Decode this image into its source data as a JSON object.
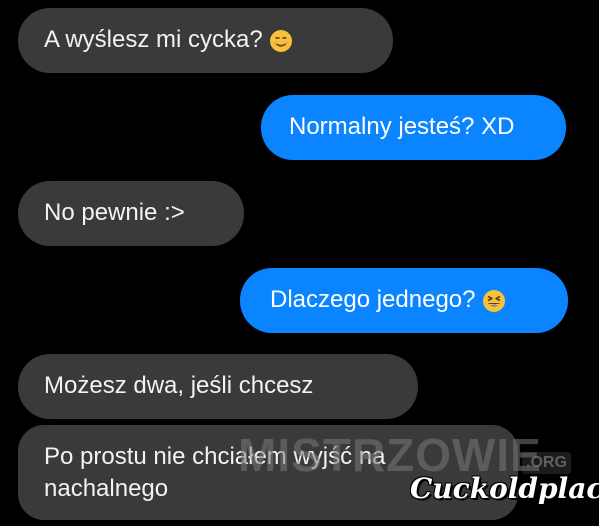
{
  "conversation": {
    "messages": [
      {
        "sender": "incoming",
        "text": "A wyślesz mi cycka?",
        "emoji": "smiling-face-emoji"
      },
      {
        "sender": "outgoing",
        "text": "Normalny jesteś? XD"
      },
      {
        "sender": "incoming",
        "text": "No pewnie :>"
      },
      {
        "sender": "outgoing",
        "text": "Dlaczego jednego?",
        "emoji": "grinning-squinting-face-emoji"
      },
      {
        "sender": "incoming",
        "text": "Możesz dwa, jeśli chcesz"
      },
      {
        "sender": "incoming",
        "line1": "Po prostu nie chciałem wyjść na",
        "line2": "nachalnego"
      }
    ]
  },
  "watermarks": {
    "mistrzowie": "MISTRZOWIE",
    "mistrzowie_suffix": ".ORG",
    "cuckoldplace": "Cuckoldplace"
  },
  "colors": {
    "background": "#000000",
    "incoming_bubble": "#3a3a3c",
    "outgoing_bubble": "#0a84ff"
  }
}
